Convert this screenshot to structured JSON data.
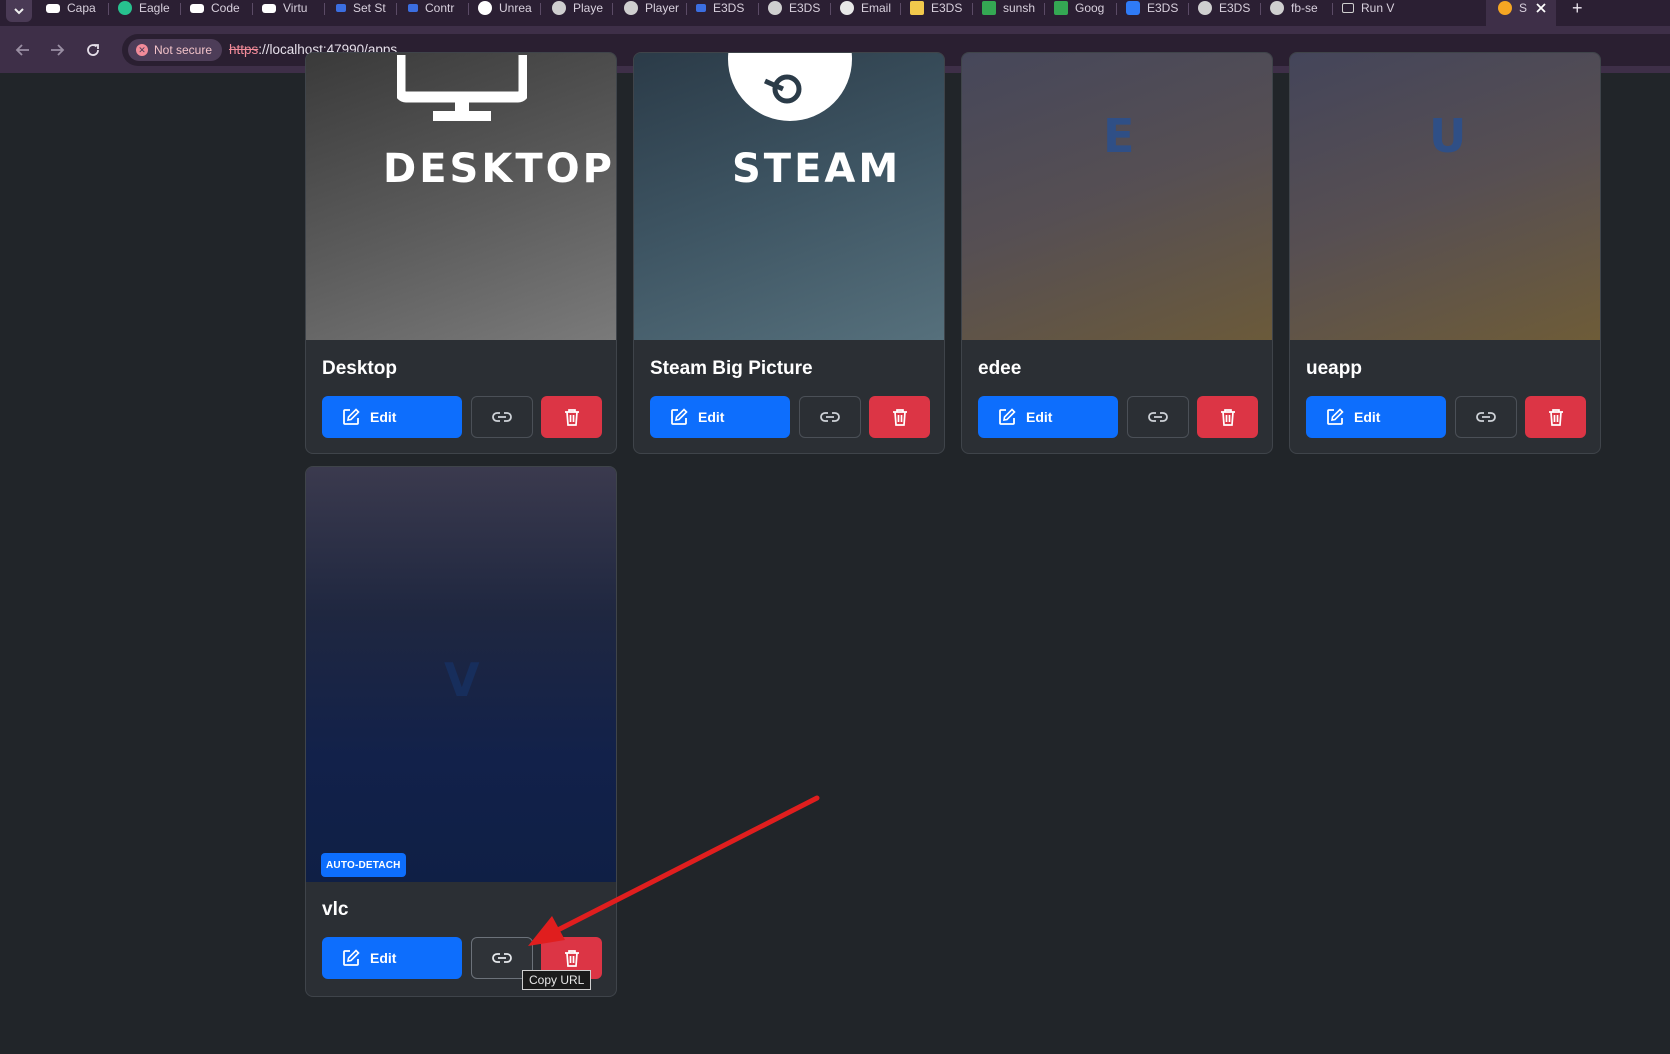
{
  "browser": {
    "tabs": [
      {
        "label": "Capa",
        "icon": "webflow-icon",
        "color": "#ffffff"
      },
      {
        "label": "Eagle",
        "icon": "eagle-icon",
        "color": "#27c28f"
      },
      {
        "label": "Code",
        "icon": "webflow-icon",
        "color": "#ffffff"
      },
      {
        "label": "Virtu",
        "icon": "webflow-icon",
        "color": "#ffffff"
      },
      {
        "label": "Set St",
        "icon": "unreal-arrow-icon",
        "color": "#3b6ee0"
      },
      {
        "label": "Contr",
        "icon": "unreal-arrow-icon",
        "color": "#3b6ee0"
      },
      {
        "label": "Unrea",
        "icon": "unreal-icon",
        "color": "#ffffff"
      },
      {
        "label": "Playe",
        "icon": "globe-icon",
        "color": "#cfcfcf"
      },
      {
        "label": "Player",
        "icon": "globe-icon",
        "color": "#cfcfcf"
      },
      {
        "label": "E3DS",
        "icon": "unreal-arrow-icon",
        "color": "#3b6ee0"
      },
      {
        "label": "E3DS",
        "icon": "globe-icon",
        "color": "#cfcfcf"
      },
      {
        "label": "Email",
        "icon": "openai-icon",
        "color": "#e8e8e8"
      },
      {
        "label": "E3DS",
        "icon": "wand-icon",
        "color": "#f2c94c"
      },
      {
        "label": "sunsh",
        "icon": "drive-icon",
        "color": "#34a853"
      },
      {
        "label": "Goog",
        "icon": "drive-icon",
        "color": "#34a853"
      },
      {
        "label": "E3DS",
        "icon": "app-icon",
        "color": "#2f7bf6"
      },
      {
        "label": "E3DS",
        "icon": "globe-icon",
        "color": "#cfcfcf"
      },
      {
        "label": "fb-se",
        "icon": "globe-icon",
        "color": "#cfcfcf"
      },
      {
        "label": "Run V",
        "icon": "window-icon",
        "color": "#cfcfcf"
      },
      {
        "label": "S",
        "icon": "sunshine-icon",
        "color": "#f5a623"
      }
    ],
    "security_label": "Not secure",
    "url_scheme": "https",
    "url_rest": "://localhost:47990/apps"
  },
  "apps": [
    {
      "name": "Desktop",
      "art_text": "DESKTOP",
      "edit_label": "Edit"
    },
    {
      "name": "Steam Big Picture",
      "art_text": "STEAM",
      "edit_label": "Edit"
    },
    {
      "name": "edee",
      "art_letter": "E",
      "edit_label": "Edit"
    },
    {
      "name": "ueapp",
      "art_letter": "U",
      "edit_label": "Edit"
    },
    {
      "name": "vlc",
      "art_letter": "V",
      "badge": "AUTO-DETACH",
      "edit_label": "Edit"
    }
  ],
  "tooltip": "Copy URL",
  "colors": {
    "edit": "#0d6efd",
    "delete": "#dc3545",
    "annotation_arrow": "#e01e1e"
  }
}
